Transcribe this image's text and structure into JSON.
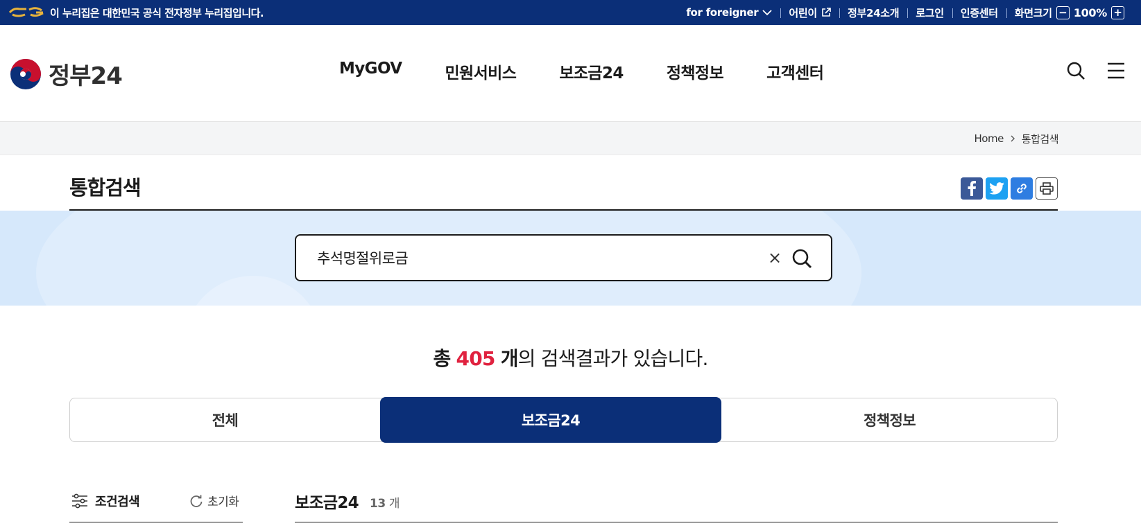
{
  "topbar": {
    "notice": "이 누리집은 대한민국 공식 전자정부 누리집입니다.",
    "foreigner": "for foreigner",
    "kids": "어린이",
    "about": "정부24소개",
    "login": "로그인",
    "cert": "인증센터",
    "zoom_label": "화면크기",
    "zoom_minus": "−",
    "zoom_value": "100%",
    "zoom_plus": "+"
  },
  "header": {
    "logo_text": "정부24",
    "nav": [
      "MyGOV",
      "민원서비스",
      "보조금24",
      "정책정보",
      "고객센터"
    ]
  },
  "breadcrumb": {
    "home": "Home",
    "current": "통합검색"
  },
  "page": {
    "title": "통합검색"
  },
  "search": {
    "query": "추석명절위로금",
    "clear": "×"
  },
  "result": {
    "prefix": "총",
    "count": "405",
    "unit": "개",
    "suffix": "의 검색결과가 있습니다."
  },
  "tabs": [
    {
      "label": "전체",
      "active": false
    },
    {
      "label": "보조금24",
      "active": true
    },
    {
      "label": "정책정보",
      "active": false
    }
  ],
  "filter": {
    "condition_label": "조건검색",
    "reset_label": "초기화"
  },
  "section": {
    "title": "보조금24",
    "count": "13",
    "unit": "개"
  },
  "colors": {
    "navy": "#0b2f78",
    "accent_red": "#e0223f",
    "search_band": "#d6e8fb"
  }
}
